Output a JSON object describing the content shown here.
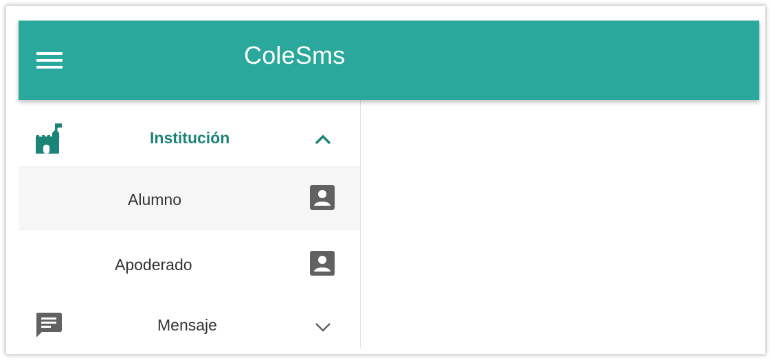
{
  "appbar": {
    "title": "ColeSms",
    "menu_icon": "hamburger-menu-icon"
  },
  "drawer": {
    "items": [
      {
        "label": "Institución",
        "icon": "castle-icon",
        "trailing_icon": "chevron-up-icon",
        "expanded": true
      },
      {
        "label": "Alumno",
        "icon": "account-box-icon",
        "sub_item": true
      },
      {
        "label": "Apoderado",
        "icon": "account-box-icon",
        "sub_item": true
      },
      {
        "label": "Mensaje",
        "icon": "message-icon",
        "trailing_icon": "chevron-down-icon",
        "expanded": false
      }
    ]
  },
  "colors": {
    "primary": "#2aa89c",
    "primary_dark": "#1c8378",
    "icon_grey": "#616161",
    "selected_row_bg": "#f6f6f6"
  }
}
